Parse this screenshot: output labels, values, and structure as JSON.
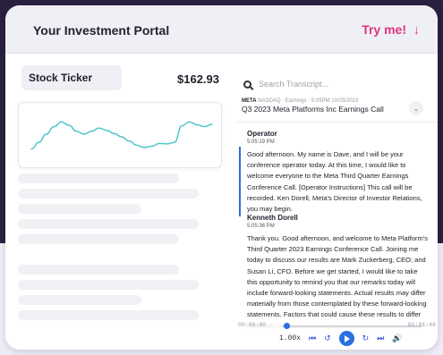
{
  "header": {
    "title": "Your Investment Portal",
    "try_me": "Try me!",
    "arrow_glyph": "↓"
  },
  "ticker": {
    "label": "Stock Ticker",
    "price": "$162.93"
  },
  "chart_data": {
    "type": "line",
    "x": [
      0,
      1,
      2,
      3,
      4,
      5,
      6,
      7,
      8,
      9,
      10,
      11,
      12,
      13,
      14,
      15,
      16,
      17,
      18,
      19,
      20,
      21,
      22,
      23,
      24
    ],
    "values": [
      2.0,
      3.4,
      5.2,
      6.8,
      7.8,
      7.1,
      5.8,
      5.2,
      5.8,
      6.5,
      6.0,
      5.3,
      4.6,
      3.7,
      2.8,
      2.3,
      2.6,
      3.2,
      3.1,
      3.4,
      7.0,
      7.8,
      7.2,
      6.8,
      7.3
    ],
    "ylim": [
      0,
      10
    ],
    "color": "#4fc7c9"
  },
  "search": {
    "placeholder": "Search Transcript..."
  },
  "call": {
    "ticker": "META",
    "meta": "NASDAQ · Earnings · 5:05PM 10/25/2023",
    "title": "Q3 2023 Meta Platforms Inc Earnings Call",
    "chevron_glyph": "⌄"
  },
  "transcript": [
    {
      "speaker": "Operator",
      "time": "5:05:19 PM",
      "text": "Good afternoon. My name is Dave, and I will be your conference operator today. At this time, I would like to welcome everyone to the Meta Third Quarter Earnings Conference Call. [Operator Instructions] This call will be recorded. Ken Dorell, Meta's Director of Investor Relations, you may begin."
    },
    {
      "speaker": "Kenneth Dorell",
      "time": "5:05:36 PM",
      "text": "Thank you. Good afternoon, and welcome to Meta Platform's Third Quarter 2023 Earnings Conference Call. Joining me today to discuss our results are Mark Zuckerberg, CEO; and Susan Li, CFO. Before we get started, I would like to take this opportunity to remind you that our remarks today will include forward-looking statements. Actual results may differ materially from those contemplated by these forward-looking statements. Factors that could cause these results to differ materially are supported in today's press release and in our quarterly report on Form 10-Q filed with the SEC. Any forward-"
    }
  ],
  "player": {
    "current": "00:00:00",
    "end": "01:01:46",
    "progress": 0.03,
    "speed": "1.00x",
    "prev_glyph": "⏮",
    "back_glyph": "↺",
    "fwd_glyph": "↻",
    "next_glyph": "⏭",
    "vol_glyph": "🔊"
  }
}
